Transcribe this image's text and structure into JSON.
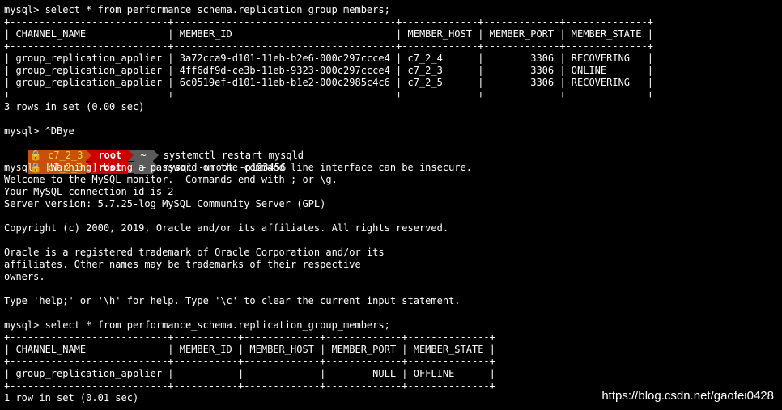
{
  "terminal": {
    "lines_before": [
      "mysql> select * from performance_schema.replication_group_members;",
      "+---------------------------+--------------------------------------+-------------+-------------+--------------+",
      "| CHANNEL_NAME              | MEMBER_ID                            | MEMBER_HOST | MEMBER_PORT | MEMBER_STATE |",
      "+---------------------------+--------------------------------------+-------------+-------------+--------------+",
      "| group_replication_applier | 3a72cca9-d101-11eb-b2e6-000c297ccce4 | c7_2_4      |        3306 | RECOVERING   |",
      "| group_replication_applier | 4ff6df9d-ce3b-11eb-9323-000c297ccce4 | c7_2_3      |        3306 | ONLINE       |",
      "| group_replication_applier | 6c0519ef-d101-11eb-b1e2-000c2985c4c6 | c7_2_5      |        3306 | RECOVERING   |",
      "+---------------------------+--------------------------------------+-------------+-------------+--------------+",
      "3 rows in set (0.00 sec)",
      "",
      "mysql> ^DBye"
    ],
    "prompts": [
      {
        "host": "c7_2_3",
        "user": "root",
        "dir": "~",
        "command": "systemctl restart mysqld"
      },
      {
        "host": "c7_2_3",
        "user": "root",
        "dir": "~",
        "command": "mysql -uroot -p123456"
      }
    ],
    "lines_after": [
      "mysql: [Warning] Using a password on the command line interface can be insecure.",
      "Welcome to the MySQL monitor.  Commands end with ; or \\g.",
      "Your MySQL connection id is 2",
      "Server version: 5.7.25-log MySQL Community Server (GPL)",
      "",
      "Copyright (c) 2000, 2019, Oracle and/or its affiliates. All rights reserved.",
      "",
      "Oracle is a registered trademark of Oracle Corporation and/or its",
      "affiliates. Other names may be trademarks of their respective",
      "owners.",
      "",
      "Type 'help;' or '\\h' for help. Type '\\c' to clear the current input statement.",
      "",
      "mysql> select * from performance_schema.replication_group_members;",
      "+---------------------------+-----------+-------------+-------------+--------------+",
      "| CHANNEL_NAME              | MEMBER_ID | MEMBER_HOST | MEMBER_PORT | MEMBER_STATE |",
      "+---------------------------+-----------+-------------+-------------+--------------+",
      "| group_replication_applier |           |             |        NULL | OFFLINE      |",
      "+---------------------------+-----------+-------------+-------------+--------------+",
      "1 row in set (0.01 sec)"
    ]
  },
  "watermark": "https://blog.csdn.net/gaofei0428"
}
